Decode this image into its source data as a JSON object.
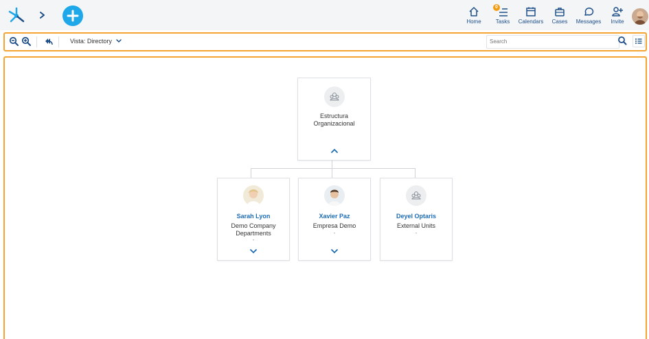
{
  "header": {
    "nav": [
      {
        "label": "Home",
        "icon": "home-icon"
      },
      {
        "label": "Tasks",
        "icon": "tasks-icon",
        "badge": "0"
      },
      {
        "label": "Calendars",
        "icon": "calendar-icon"
      },
      {
        "label": "Cases",
        "icon": "briefcase-icon"
      },
      {
        "label": "Messages",
        "icon": "message-icon"
      },
      {
        "label": "Invite",
        "icon": "invite-icon"
      }
    ]
  },
  "toolbar": {
    "vista_label": "Vista: Directory",
    "search_placeholder": "Search"
  },
  "org": {
    "root": {
      "title": "Estructura Organizacional"
    },
    "children": [
      {
        "name": "Sarah Lyon",
        "sub": "Demo Company Departments",
        "dash": "-"
      },
      {
        "name": "Xavier Paz",
        "sub": "Empresa Demo",
        "dash": "-"
      },
      {
        "name": "Deyel Optaris",
        "sub": "External Units",
        "dash": "-"
      }
    ]
  },
  "colors": {
    "accent": "#f6a431",
    "brand_blue": "#1ea7e9",
    "nav_blue": "#1d4e89",
    "link_blue": "#1d6db5"
  }
}
